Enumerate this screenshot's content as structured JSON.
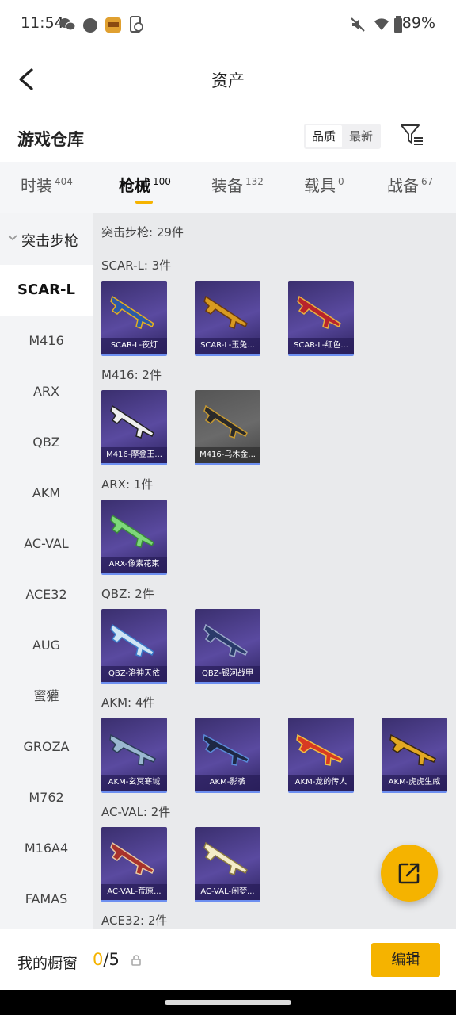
{
  "status_bar": {
    "time": "11:54",
    "battery": "89%",
    "icons": [
      "wechat-icon",
      "circle-app-icon",
      "game-app-icon",
      "phone-clean-icon",
      "mute-icon",
      "wifi-icon",
      "battery-icon"
    ]
  },
  "header": {
    "title": "资产",
    "back_icon": "back-arrow-icon"
  },
  "section": {
    "title": "游戏仓库",
    "sort_options": [
      "品质",
      "最新"
    ],
    "selected_sort": "品质",
    "filter_icon": "filter-icon"
  },
  "tabs": [
    {
      "label": "时装",
      "count": "404"
    },
    {
      "label": "枪械",
      "count": "100",
      "active": true
    },
    {
      "label": "装备",
      "count": "132"
    },
    {
      "label": "载具",
      "count": "0"
    },
    {
      "label": "战备",
      "count": "67"
    }
  ],
  "sidebar": {
    "group_label": "突击步枪",
    "items": [
      "SCAR-L",
      "M416",
      "ARX",
      "QBZ",
      "AKM",
      "AC-VAL",
      "ACE32",
      "AUG",
      "蜜獾",
      "GROZA",
      "M762",
      "M16A4",
      "FAMAS"
    ],
    "active_item": "SCAR-L"
  },
  "content": {
    "total": "突击步枪: 29件",
    "groups": [
      {
        "title": "SCAR-L: 3件",
        "items": [
          "SCAR-L-夜灯",
          "SCAR-L-玉兔...",
          "SCAR-L-红色..."
        ]
      },
      {
        "title": "M416: 2件",
        "items": [
          "M416-摩登王...",
          "M416-乌木金..."
        ]
      },
      {
        "title": "ARX: 1件",
        "items": [
          "ARX-像素花束"
        ]
      },
      {
        "title": "QBZ: 2件",
        "items": [
          "QBZ-洛神天依",
          "QBZ-银河战甲"
        ]
      },
      {
        "title": "AKM: 4件",
        "items": [
          "AKM-玄冥寒域",
          "AKM-影袭",
          "AKM-龙的传人",
          "AKM-虎虎生威"
        ]
      },
      {
        "title": "AC-VAL: 2件",
        "items": [
          "AC-VAL-荒原...",
          "AC-VAL-闲梦..."
        ]
      },
      {
        "title": "ACE32: 2件",
        "items": []
      }
    ],
    "colors": {
      "card_bg": "#4a3c8c",
      "card_gray_bg": "#5e5e5e",
      "underline": "#6d8ff0"
    }
  },
  "fab": {
    "icon": "share-external-icon"
  },
  "bottom": {
    "label": "我的橱窗",
    "current": "0",
    "separator": "/",
    "max": "5",
    "lock_icon": "lock-icon",
    "edit_label": "编辑"
  },
  "accent": "#f5b300"
}
